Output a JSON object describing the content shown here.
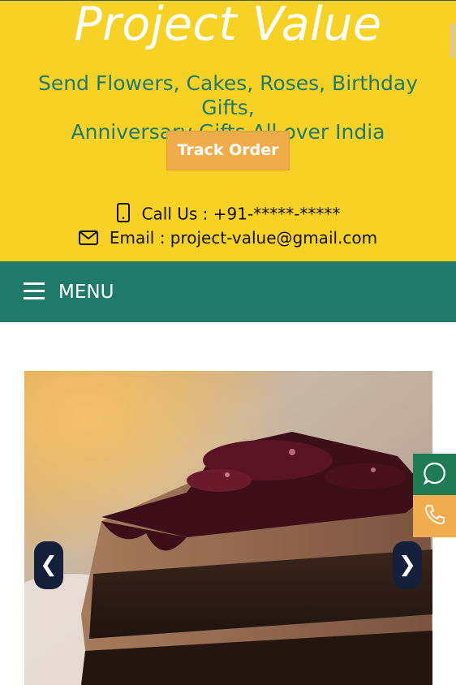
{
  "header": {
    "brand": "Project Value",
    "tagline_line1": "Send Flowers, Cakes, Roses, Birthday Gifts,",
    "tagline_line2": "Anniversary Gifts All over India",
    "track_label": "Track Order",
    "call_text": "Call Us : +91-*****-*****",
    "email_text": "Email : project-value@gmail.com"
  },
  "nav": {
    "menu_label": "MENU"
  },
  "slider": {
    "prev": "❮",
    "next": "❯",
    "image_icon": "chocolate-cake-photo"
  },
  "floating": {
    "whatsapp_icon": "whatsapp-icon",
    "phone_icon": "phone-icon"
  },
  "colors": {
    "header_bg": "#f7d225",
    "tagline": "#1d7a6c",
    "track_button": "#eeac4a",
    "nav_bg": "#1f7a6a",
    "whatsapp_bg": "#1e7b56",
    "phone_bg": "#f0ac4f",
    "arrow_bg": "#14203a"
  }
}
